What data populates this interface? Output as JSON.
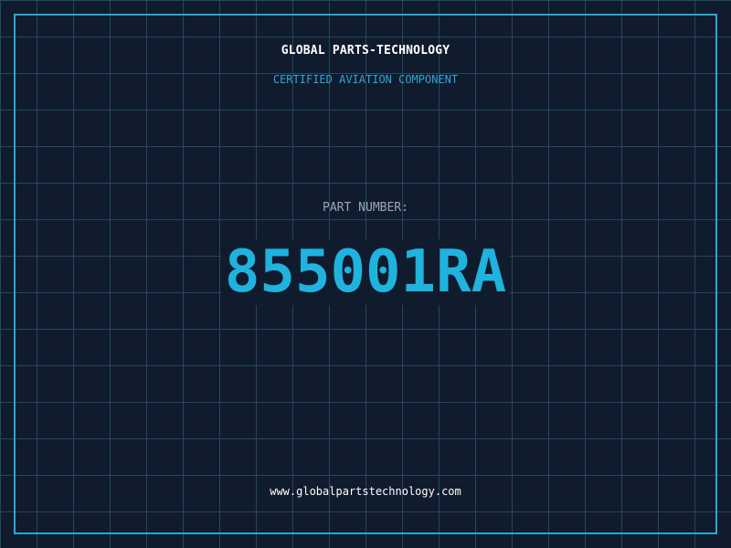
{
  "brand": {
    "name": "GLOBAL PARTS-TECHNOLOGY",
    "tagline": "CERTIFIED AVIATION COMPONENT"
  },
  "part": {
    "label": "PART NUMBER:",
    "number": "855001RA"
  },
  "footer": {
    "website": "www.globalpartstechnology.com"
  },
  "colors": {
    "background": "#111b2e",
    "grid": "#1f4a5e",
    "accent": "#1fb3dd",
    "frame": "#22a9cf",
    "label": "#9aa8bb",
    "text": "#ffffff"
  }
}
